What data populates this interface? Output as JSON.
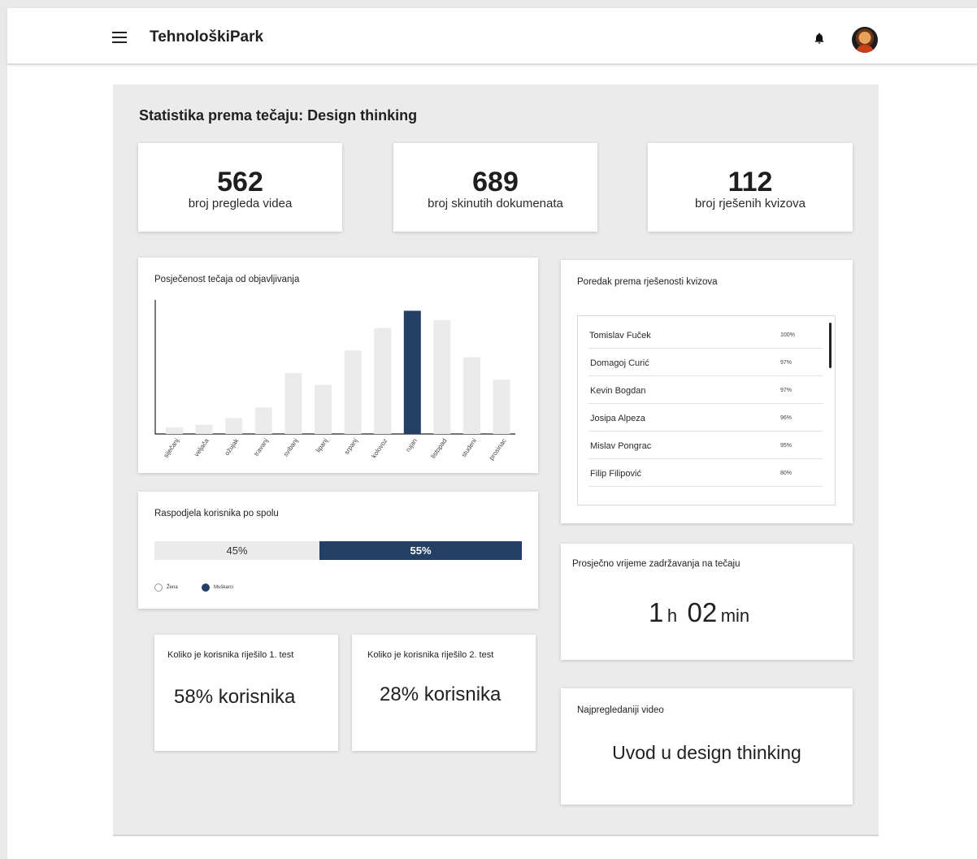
{
  "app": {
    "title": "TehnološkiPark"
  },
  "page": {
    "title": "Statistika prema tečaju: Design thinking"
  },
  "stats": [
    {
      "value": "562",
      "label": "broj pregleda videa"
    },
    {
      "value": "689",
      "label": "broj skinutih dokumenata"
    },
    {
      "value": "112",
      "label": "broj rješenih kvizova"
    }
  ],
  "visits": {
    "title": "Posječenost tečaja od objavljivanja",
    "chart_data": {
      "type": "bar",
      "categories": [
        "siječanj",
        "veljača",
        "ožujak",
        "travanj",
        "svibanj",
        "lipanj",
        "srpanj",
        "kolovoz",
        "rujan",
        "listopad",
        "studeni",
        "prosinac"
      ],
      "values": [
        5,
        7,
        12,
        20,
        46,
        37,
        63,
        80,
        93,
        86,
        58,
        41
      ],
      "highlighted": "rujan",
      "ylim": [
        0,
        100
      ],
      "colors": {
        "bar": "#ebebeb",
        "highlight": "#233f63"
      }
    }
  },
  "ranking": {
    "title": "Poredak prema rješenosti kvizova",
    "rows": [
      {
        "name": "Tomislav Fuček",
        "pct": "100%"
      },
      {
        "name": "Domagoj Curić",
        "pct": "97%"
      },
      {
        "name": "Kevin Bogdan",
        "pct": "97%"
      },
      {
        "name": "Josipa Alpeza",
        "pct": "96%"
      },
      {
        "name": "Mislav Pongrac",
        "pct": "95%"
      },
      {
        "name": "Filip Filipović",
        "pct": "80%"
      }
    ]
  },
  "gender": {
    "title": "Raspodjela korisnika po spolu",
    "female_pct": "45%",
    "male_pct": "55%",
    "female_fraction": 0.45,
    "female_label": "Žena",
    "male_label": "Muškarci"
  },
  "avg_time": {
    "title": "Prosječno vrijeme zadržavanja na tečaju",
    "hours": "1",
    "hours_unit": "h",
    "minutes": "02",
    "minutes_unit": "min"
  },
  "test1": {
    "title": "Koliko je korisnika riješilo 1. test",
    "value": "58% korisnika"
  },
  "test2": {
    "title": "Koliko je korisnika riješilo 2. test",
    "value": "28% korisnika"
  },
  "top_video": {
    "title": "Najpregledaniji video",
    "value": "Uvod u design thinking"
  },
  "colors": {
    "accent": "#233f63",
    "bar_bg": "#ebebeb",
    "content_bg": "#ebebeb"
  }
}
